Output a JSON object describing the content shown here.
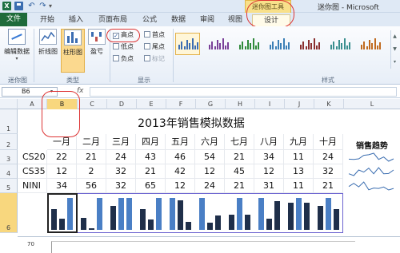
{
  "titlebar": {
    "app_icon": "X",
    "context_group": "迷你图工具",
    "window_title": "迷你图 - Microsoft"
  },
  "tabs": {
    "file": "文件",
    "home": "开始",
    "insert": "插入",
    "page_layout": "页面布局",
    "formulas": "公式",
    "data": "数据",
    "review": "审阅",
    "view": "视图",
    "design": "设计"
  },
  "ribbon": {
    "edit_data": "编辑数据",
    "group_sparkline": "迷你图",
    "line": "折线图",
    "column": "柱形图",
    "winloss": "盈亏",
    "group_type": "类型",
    "checks": {
      "high": "高点",
      "low": "低点",
      "negative": "负点",
      "first": "首点",
      "last": "尾点",
      "markers": "标记"
    },
    "check_state": {
      "high": true,
      "low": false,
      "negative": false,
      "first": false,
      "last": false,
      "markers": false
    },
    "group_show": "显示",
    "group_style": "样式",
    "style_colors": [
      "#3c6db2",
      "#7a3f98",
      "#2f8a3a",
      "#3b7fb6",
      "#8a2f2f",
      "#3a8f8f",
      "#c06a1f"
    ]
  },
  "formula_bar": {
    "name_box": "B6",
    "fx": "fx",
    "value": ""
  },
  "sheet": {
    "columns": [
      "A",
      "B",
      "C",
      "D",
      "E",
      "F",
      "G",
      "H",
      "I",
      "J",
      "K",
      "L"
    ],
    "active_column": "B",
    "rows": [
      "1",
      "2",
      "3",
      "4",
      "5",
      "6"
    ],
    "active_row": "6",
    "title": "2013年销售模拟数据",
    "months": [
      "一月",
      "二月",
      "三月",
      "四月",
      "五月",
      "六月",
      "七月",
      "八月",
      "九月",
      "十月"
    ],
    "trend_header": "销售趋势",
    "data_rows": [
      {
        "label": "CS20",
        "values": [
          22,
          21,
          24,
          43,
          46,
          54,
          21,
          34,
          11,
          24
        ]
      },
      {
        "label": "CS35",
        "values": [
          12,
          2,
          32,
          21,
          42,
          12,
          45,
          12,
          13,
          32
        ]
      },
      {
        "label": "NINI",
        "values": [
          34,
          56,
          32,
          65,
          12,
          24,
          21,
          31,
          11,
          21
        ]
      }
    ],
    "chart_axis_label": "70"
  },
  "colors": {
    "sparkline_bar": "#4a7fc5",
    "sparkline_high": "#1f2f4a",
    "trend_line": "#3a6db0",
    "range_border": "#6c63d0",
    "annotation": "#dd3333"
  }
}
